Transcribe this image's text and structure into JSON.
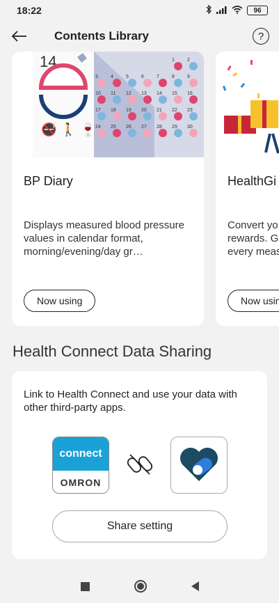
{
  "status_bar": {
    "time": "18:22",
    "battery": "96",
    "icons": [
      "bluetooth-icon",
      "signal-icon",
      "wifi-icon",
      "battery-icon"
    ]
  },
  "app_bar": {
    "title": "Contents Library",
    "help_glyph": "?"
  },
  "cards": [
    {
      "title": "BP Diary",
      "description": "Displays measured blood pressure values in calendar format, morning/evening/day gr…",
      "button": "Now using",
      "art": {
        "day": "14",
        "calendar_numbers": [
          "1",
          "2",
          "3",
          "4",
          "5",
          "6",
          "7",
          "8",
          "9",
          "10",
          "11",
          "12",
          "13",
          "14",
          "15",
          "16",
          "17",
          "18",
          "19",
          "20",
          "21",
          "22",
          "23",
          "24",
          "25",
          "26",
          "27",
          "28",
          "29",
          "30"
        ]
      }
    },
    {
      "title": "HealthGi",
      "description": "Convert yo rewards. G every meas",
      "button": "Now usin"
    }
  ],
  "health_connect": {
    "section_title": "Health Connect Data Sharing",
    "description": "Link to Health Connect and use your data with other third-party apps.",
    "omron_logo_top": "connect",
    "omron_logo_bottom": "OMRON",
    "share_button": "Share setting"
  },
  "colors": {
    "accent_blue": "#1aa1d6",
    "bp_pink": "#e0456e",
    "bp_navy": "#1c3f73",
    "background": "#f2f2f2",
    "card": "#ffffff"
  }
}
